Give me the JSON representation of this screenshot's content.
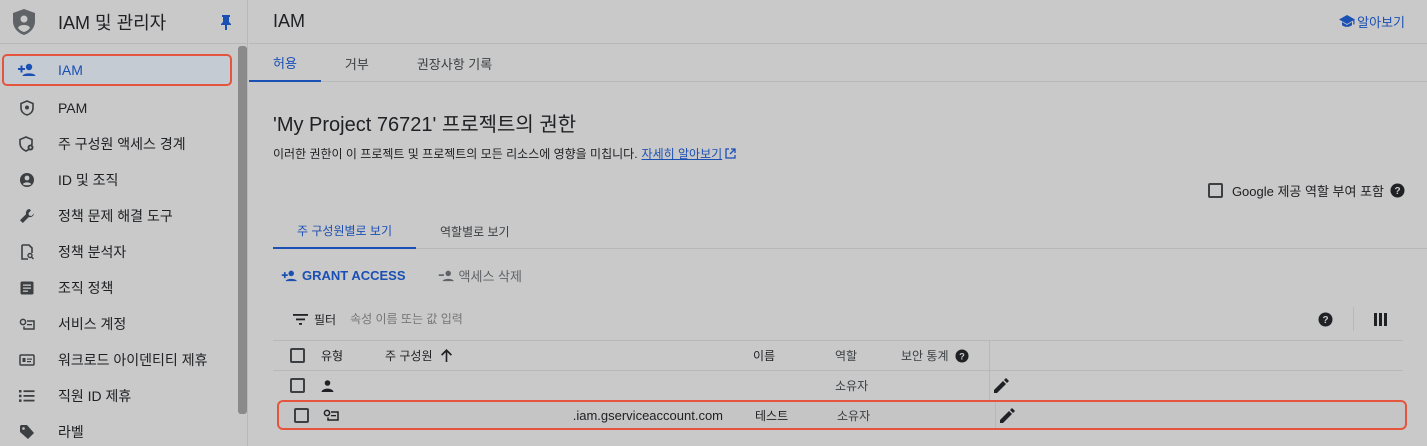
{
  "sidebar": {
    "title": "IAM 및 관리자",
    "items": [
      {
        "label": "IAM",
        "icon": "person-add-icon"
      },
      {
        "label": "PAM",
        "icon": "shield-lock-icon"
      },
      {
        "label": "주 구성원 액세스 경계",
        "icon": "shield-gear-icon"
      },
      {
        "label": "ID 및 조직",
        "icon": "account-circle-icon"
      },
      {
        "label": "정책 문제 해결 도구",
        "icon": "wrench-icon"
      },
      {
        "label": "정책 분석자",
        "icon": "document-search-icon"
      },
      {
        "label": "조직 정책",
        "icon": "article-icon"
      },
      {
        "label": "서비스 계정",
        "icon": "service-account-icon"
      },
      {
        "label": "워크로드 아이덴티티 제휴",
        "icon": "id-card-icon"
      },
      {
        "label": "직원 ID 제휴",
        "icon": "list-icon"
      },
      {
        "label": "라벨",
        "icon": "tag-icon"
      }
    ]
  },
  "header": {
    "title": "IAM",
    "learn_label": "알아보기"
  },
  "tabs": [
    {
      "label": "허용"
    },
    {
      "label": "거부"
    },
    {
      "label": "권장사항 기록"
    }
  ],
  "permissions": {
    "title": "'My Project 76721' 프로젝트의 권한",
    "description": "이러한 권한이 이 프로젝트 및 프로젝트의 모든 리소스에 영향을 미칩니다.",
    "link": "자세히 알아보기",
    "google_roles_label": "Google 제공 역할 부여 포함"
  },
  "view_tabs": [
    {
      "label": "주 구성원별로 보기"
    },
    {
      "label": "역할별로 보기"
    }
  ],
  "actions": {
    "grant": "GRANT ACCESS",
    "remove": "액세스 삭제"
  },
  "filter": {
    "label": "필터",
    "placeholder": "속성 이름 또는 값 입력"
  },
  "table": {
    "headers": {
      "type": "유형",
      "principal": "주 구성원",
      "name": "이름",
      "role": "역할",
      "security": "보안 통계"
    },
    "rows": [
      {
        "type_icon": "person-icon",
        "principal": "",
        "name": "",
        "role": "소유자"
      },
      {
        "type_icon": "service-account-icon",
        "principal": ".iam.gserviceaccount.com",
        "name": "테스트",
        "role": "소유자"
      }
    ]
  },
  "colors": {
    "accent": "#1a4fb4",
    "highlight": "#e5553d"
  }
}
